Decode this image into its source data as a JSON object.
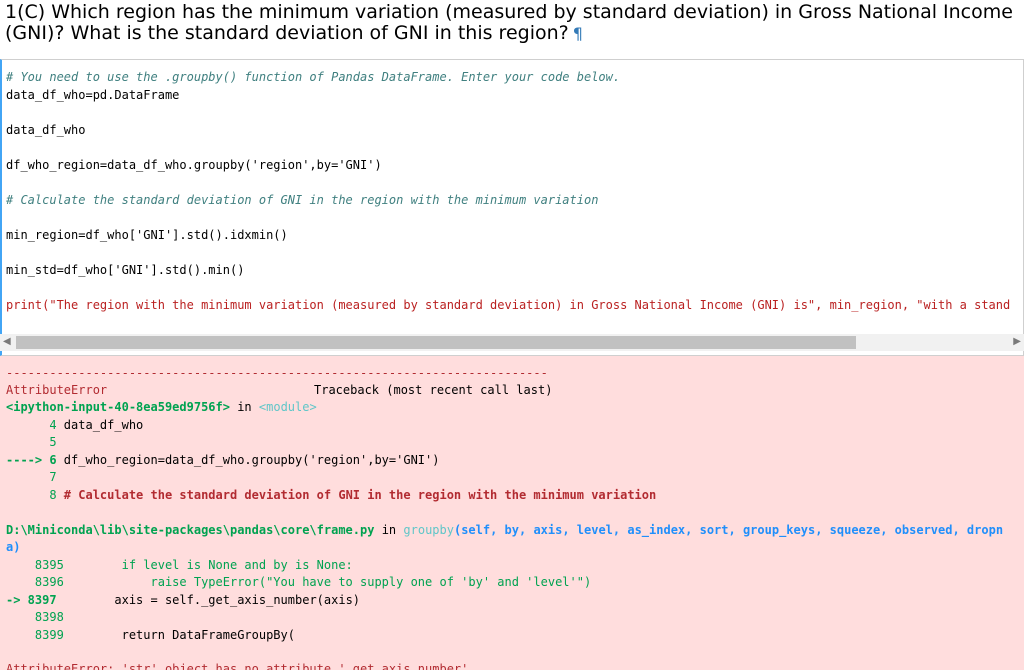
{
  "heading": {
    "line1": "1(C) Which region has the minimum variation (measured by standard deviation) in Gross National Income",
    "line2": "(GNI)? What is the standard deviation of GNI in this region?",
    "pilcrow": "¶"
  },
  "code_cell": {
    "lines": [
      "# You need to use the .groupby() function of Pandas DataFrame. Enter your code below.",
      "data_df_who=pd.DataFrame",
      "data_df_who",
      "df_who_region=data_df_who.groupby('region',by='GNI')",
      "# Calculate the standard deviation of GNI in the region with the minimum variation",
      "min_region=df_who['GNI'].std().idxmin()",
      "min_std=df_who['GNI'].std().min()",
      "print(\"The region with the minimum variation (measured by standard deviation) in Gross National Income (GNI) is\", min_region, \"with a stand"
    ]
  },
  "scrollbar": {
    "left_arrow": "◀",
    "right_arrow": "▶"
  },
  "output": {
    "dashes": "---------------------------------------------------------------------------",
    "error_name": "AttributeError",
    "traceback_label": "Traceback (most recent call last)",
    "input_ref": "<ipython-input-40-8ea59ed9756f>",
    "in_word": "in",
    "module_ref": "<module>",
    "ctx": [
      {
        "marker": "      4",
        "code": " data_df_who"
      },
      {
        "marker": "      5",
        "code": ""
      },
      {
        "marker": "----> 6",
        "code": " df_who_region=data_df_who.groupby('region',by='GNI')"
      },
      {
        "marker": "      7",
        "code": ""
      },
      {
        "marker": "      8",
        "code": " # Calculate the standard deviation of GNI in the region with the minimum variation"
      }
    ],
    "file_path": "D:\\Miniconda\\lib\\site-packages\\pandas\\core\\frame.py",
    "func_name": "groupby",
    "func_sig": "(self, by, axis, level, as_index, sort, group_keys, squeeze, observed, dropn",
    "wrap_tail": "a)",
    "frame_lines": [
      {
        "num": "    8395",
        "code": "        if level is None and by is None:"
      },
      {
        "num": "    8396",
        "code": "            raise TypeError(\"You have to supply one of 'by' and 'level'\")"
      },
      {
        "num": "-> 8397",
        "code": "        axis = self._get_axis_number(axis)"
      },
      {
        "num": "    8398",
        "code": ""
      },
      {
        "num": "    8399",
        "code": "        return DataFrameGroupBy("
      }
    ],
    "final_error": "AttributeError: 'str' object has no attribute '_get_axis_number'"
  }
}
